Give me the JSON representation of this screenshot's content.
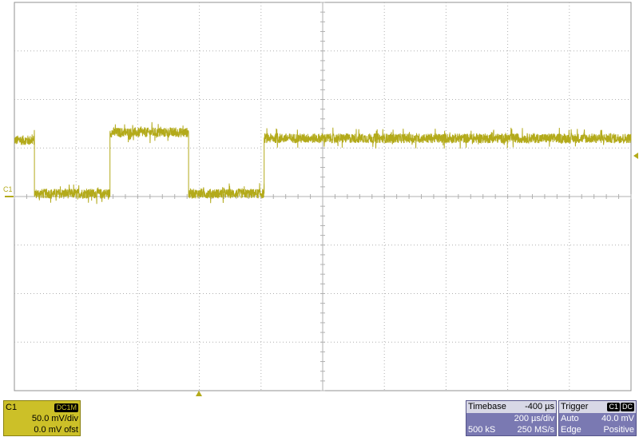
{
  "colors": {
    "trace": "#b3aa1a",
    "grid": "#b0b0b0",
    "channel_box": "#ccc028",
    "info_box": "#7a79b2"
  },
  "channel": {
    "marker_label": "C1",
    "name": "C1",
    "coupling": "DC1M",
    "volts_div": "50.0 mV/div",
    "offset": "0.0 mV ofst"
  },
  "timebase": {
    "title": "Timebase",
    "delay": "-400 µs",
    "time_div": "200 µs/div",
    "samples": "500 kS",
    "rate": "250 MS/s"
  },
  "trigger": {
    "title": "Trigger",
    "source": "C1",
    "coupling": "DC",
    "mode": "Auto",
    "level": "40.0 mV",
    "type": "Edge",
    "slope": "Positive"
  },
  "chart_data": {
    "type": "line",
    "grid": true,
    "divisions": {
      "x": 10,
      "y": 8
    },
    "xlim": [
      -2000,
      2000
    ],
    "ylim": [
      -200,
      200
    ],
    "x_units": "µs",
    "y_units": "mV",
    "series": [
      {
        "x": [
          -2000,
          -1870,
          -1870,
          -1380,
          -1380,
          -870,
          -870,
          -380,
          -380,
          2000
        ],
        "y": [
          58,
          58,
          3,
          3,
          66,
          66,
          3,
          3,
          60,
          60
        ],
        "noise_mV": 10
      }
    ]
  }
}
